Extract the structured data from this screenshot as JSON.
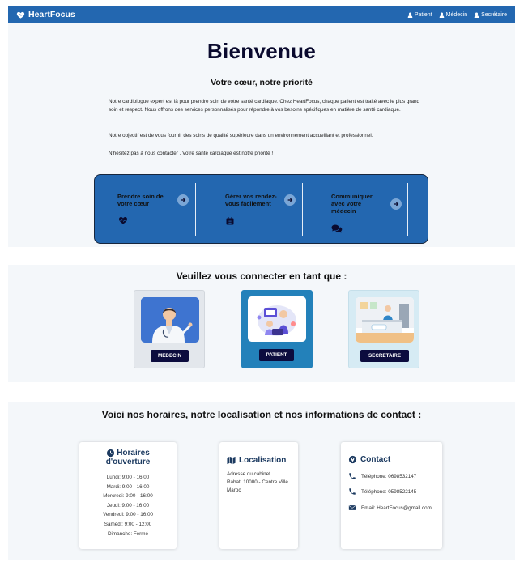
{
  "navbar": {
    "brand": "HeartFocus",
    "links": [
      "Patient",
      "Médecin",
      "Secrétaire"
    ]
  },
  "hero": {
    "title": "Bienvenue",
    "subtitle": "Votre cœur, notre priorité",
    "paragraph1": "Notre cardiologue expert est là pour prendre soin de votre santé cardiaque. Chez HeartFocus, chaque patient est traité avec le plus grand soin et respect. Nous offrons des services personnalisés pour répondre à vos besoins spécifiques en matière de santé cardiaque.",
    "paragraph2": "Notre objectif est de vous fournir des soins de qualité supérieure dans un environnement accueillant et professionnel.",
    "paragraph3": "N'hésitez pas à nous contacter . Votre santé cardiaque est notre priorité !"
  },
  "features": [
    {
      "title": "Prendre soin de votre cœur",
      "icon": "heartbeat-icon"
    },
    {
      "title": "Gérer vos rendez-vous facilement",
      "icon": "calendar-icon"
    },
    {
      "title": "Communiquer avec votre médecin",
      "icon": "comments-icon"
    }
  ],
  "login": {
    "heading": "Veuillez vous connecter en tant que :",
    "roles": [
      {
        "label": "MEDECIN",
        "bg": "#e3e7ec"
      },
      {
        "label": "PATIENT",
        "bg": "#2381ba"
      },
      {
        "label": "SECRETAIRE",
        "bg": "#d6ebf4"
      }
    ]
  },
  "info": {
    "heading": "Voici nos horaires, notre localisation et nos informations de contact :",
    "hours": {
      "title_line1": "Horaires",
      "title_line2": "d'ouverture",
      "days": [
        "Lundi: 9:00 - 16:00",
        "Mardi: 9:00 - 16:00",
        "Mercredi: 9:00 - 16:00",
        "Jeudi: 9:00 - 16:00",
        "Vendredi: 9:00 - 16:00",
        "Samedi: 9:00 - 12:00",
        "Dimanche: Fermé"
      ]
    },
    "location": {
      "title": "Localisation",
      "lines": [
        "Adresse du cabinet",
        "Rabat, 10000 - Centre Ville",
        "Maroc"
      ]
    },
    "contact": {
      "title": "Contact",
      "phone1": "Téléphone: 0698532147",
      "phone2": "Téléphone: 0598522145",
      "email": "Email: HeartFocus@gmail.com"
    }
  },
  "colors": {
    "primary": "#2367b0",
    "dark_navy": "#0c0c3e",
    "section_bg": "#f4f7fa"
  }
}
